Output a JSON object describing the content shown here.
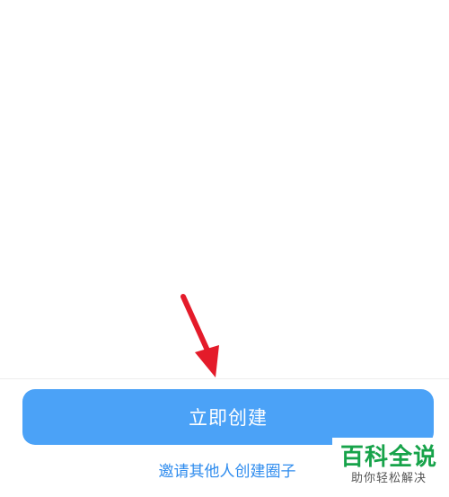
{
  "actions": {
    "create_now_label": "立即创建",
    "invite_label": "邀请其他人创建圈子"
  },
  "watermark": {
    "title": "百科全说",
    "subtitle": "助你轻松解决"
  },
  "annotation": {
    "arrow_color": "#e41b2a",
    "arrow_icon": "red-pointer-arrow-icon"
  },
  "colors": {
    "primary_button": "#4ba2f7",
    "link": "#2f8cee",
    "watermark_green": "#17a34a"
  }
}
